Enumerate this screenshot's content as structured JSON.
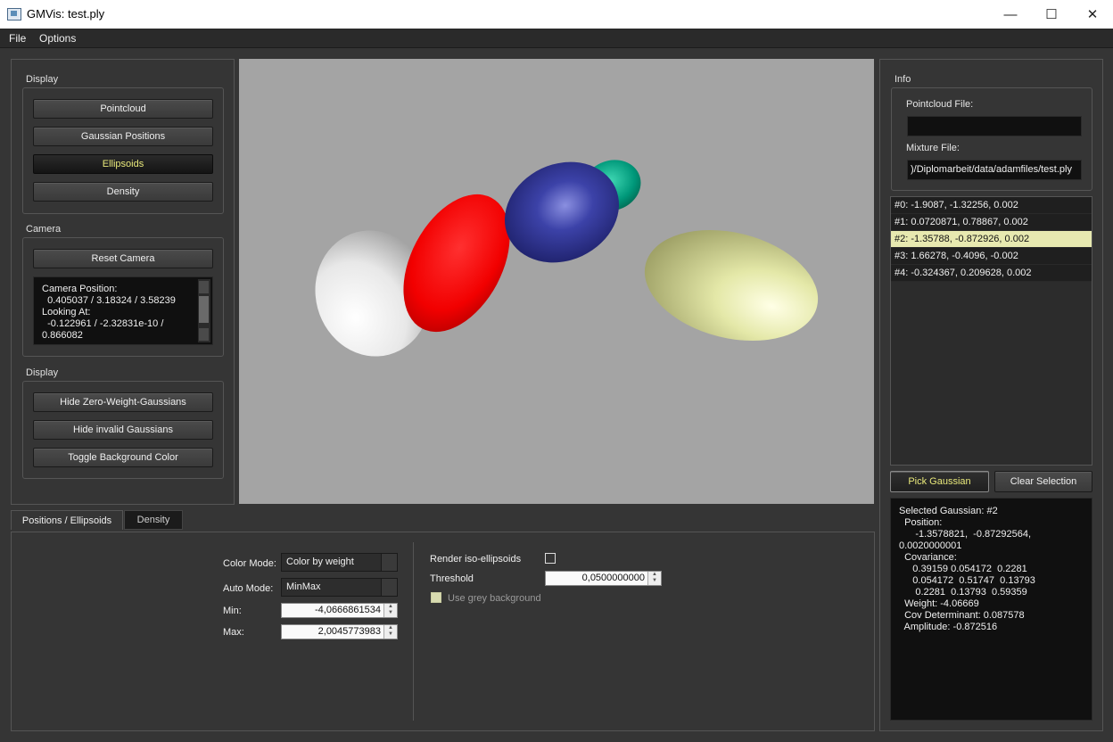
{
  "window": {
    "title": "GMVis: test.ply",
    "minimize": "—",
    "maximize": "☐",
    "close": "✕"
  },
  "menu": {
    "file": "File",
    "options": "Options"
  },
  "display1": {
    "label": "Display",
    "buttons": [
      "Pointcloud",
      "Gaussian Positions",
      "Ellipsoids",
      "Density"
    ],
    "active": "Ellipsoids"
  },
  "camera": {
    "label": "Camera",
    "reset": "Reset Camera",
    "info_lines": [
      "Camera Position:",
      "  0.405037 / 3.18324 / 3.58239",
      "Looking At:",
      "  -0.122961 / -2.32831e-10 /",
      "0.866082"
    ]
  },
  "display2": {
    "label": "Display",
    "buttons": [
      "Hide Zero-Weight-Gaussians",
      "Hide invalid Gaussians",
      "Toggle Background Color"
    ]
  },
  "viewport": {
    "background": "#a4a4a4",
    "ellipsoids": [
      {
        "name": "white-ellipsoid",
        "color": "#ffffff"
      },
      {
        "name": "red-ellipsoid",
        "color": "#ff0000"
      },
      {
        "name": "navy-ellipsoid",
        "color": "#2a2f8c"
      },
      {
        "name": "teal-ellipsoid",
        "color": "#00a888"
      },
      {
        "name": "cream-ellipsoid",
        "color": "#e4e8a8"
      }
    ]
  },
  "info": {
    "label": "Info",
    "pointcloud_label": "Pointcloud File:",
    "pointcloud_value": "",
    "mixture_label": "Mixture File:",
    "mixture_value": ")/Diplomarbeit/data/adamfiles/test.ply"
  },
  "gaussians": {
    "items": [
      "#0: -1.9087, -1.32256, 0.002",
      "#1: 0.0720871, 0.78867, 0.002",
      "#2: -1.35788, -0.872926, 0.002",
      "#3: 1.66278, -0.4096, -0.002",
      "#4: -0.324367, 0.209628, 0.002"
    ],
    "selected_index": 2,
    "pick": "Pick Gaussian",
    "clear": "Clear Selection"
  },
  "selected_info": "Selected Gaussian: #2\n  Position:\n      -1.3578821,  -0.87292564,\n0.0020000001\n  Covariance:\n     0.39159 0.054172  0.2281\n     0.054172  0.51747  0.13793\n      0.2281  0.13793  0.59359\n  Weight: -4.06669\n  Cov Determinant: 0.087578\n  Amplitude: -0.872516",
  "tabs": {
    "positions": "Positions / Ellipsoids",
    "density": "Density",
    "active": "positions"
  },
  "settings": {
    "color_mode_label": "Color Mode:",
    "color_mode_value": "Color by weight",
    "auto_mode_label": "Auto Mode:",
    "auto_mode_value": "MinMax",
    "min_label": "Min:",
    "min_value": "-4,0666861534",
    "max_label": "Max:",
    "max_value": "2,0045773983",
    "render_iso_label": "Render iso-ellipsoids",
    "render_iso_checked": false,
    "threshold_label": "Threshold",
    "threshold_value": "0,0500000000",
    "grey_bg_label": "Use grey background",
    "grey_bg_checked": false
  }
}
